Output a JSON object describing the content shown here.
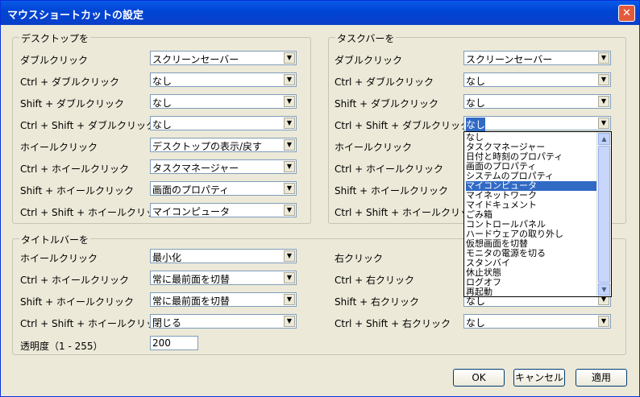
{
  "window": {
    "title": "マウスショートカットの設定",
    "close_glyph": "✕"
  },
  "desktop_group": {
    "label": "デスクトップを",
    "rows": [
      {
        "label": "ダブルクリック",
        "value": "スクリーンセーバー"
      },
      {
        "label": "Ctrl + ダブルクリック",
        "value": "なし"
      },
      {
        "label": "Shift + ダブルクリック",
        "value": "なし"
      },
      {
        "label": "Ctrl + Shift + ダブルクリック",
        "value": "なし"
      },
      {
        "label": "ホイールクリック",
        "value": "デスクトップの表示/戻す"
      },
      {
        "label": "Ctrl + ホイールクリック",
        "value": "タスクマネージャー"
      },
      {
        "label": "Shift + ホイールクリック",
        "value": "画面のプロパティ"
      },
      {
        "label": "Ctrl + Shift + ホイールクリック",
        "value": "マイコンピュータ"
      }
    ]
  },
  "taskbar_group": {
    "label": "タスクバーを",
    "rows": [
      {
        "label": "ダブルクリック",
        "value": "スクリーンセーバー"
      },
      {
        "label": "Ctrl + ダブルクリック",
        "value": "なし"
      },
      {
        "label": "Shift + ダブルクリック",
        "value": "なし"
      },
      {
        "label": "Ctrl + Shift + ダブルクリック",
        "value": "なし"
      },
      {
        "label": "ホイールクリック",
        "value": ""
      },
      {
        "label": "Ctrl + ホイールクリック",
        "value": ""
      },
      {
        "label": "Shift + ホイールクリック",
        "value": ""
      },
      {
        "label": "Ctrl + Shift + ホイールクリック",
        "value": ""
      }
    ]
  },
  "titlebar_group": {
    "label": "タイトルバーを",
    "left_rows": [
      {
        "label": "ホイールクリック",
        "value": "最小化"
      },
      {
        "label": "Ctrl + ホイールクリック",
        "value": "常に最前面を切替"
      },
      {
        "label": "Shift + ホイールクリック",
        "value": "常に最前面を切替"
      },
      {
        "label": "Ctrl + Shift + ホイールクリック",
        "value": "閉じる"
      }
    ],
    "right_rows": [
      {
        "label": "右クリック",
        "value": ""
      },
      {
        "label": "Ctrl + 右クリック",
        "value": ""
      },
      {
        "label": "Shift + 右クリック",
        "value": "なし"
      },
      {
        "label": "Ctrl + Shift + 右クリック",
        "value": "なし"
      }
    ],
    "opacity_label": "透明度（1 - 255）",
    "opacity_value": "200"
  },
  "dropdown_list": {
    "items": [
      "なし",
      "タスクマネージャー",
      "日付と時刻のプロパティ",
      "画面のプロパティ",
      "システムのプロパティ",
      "マイコンピュータ",
      "マイネットワーク",
      "マイドキュメント",
      "ごみ箱",
      "コントロールパネル",
      "ハードウェアの取り外し",
      "仮想画面を切替",
      "モニタの電源を切る",
      "スタンバイ",
      "休止状態",
      "ログオフ",
      "再起動"
    ],
    "selected": "マイコンピュータ"
  },
  "icons": {
    "arrow": "▼",
    "scroll_up": "▲",
    "scroll_down": "▼",
    "grip": "≡"
  },
  "buttons": {
    "ok": "OK",
    "cancel": "キャンセル",
    "apply": "適用"
  }
}
